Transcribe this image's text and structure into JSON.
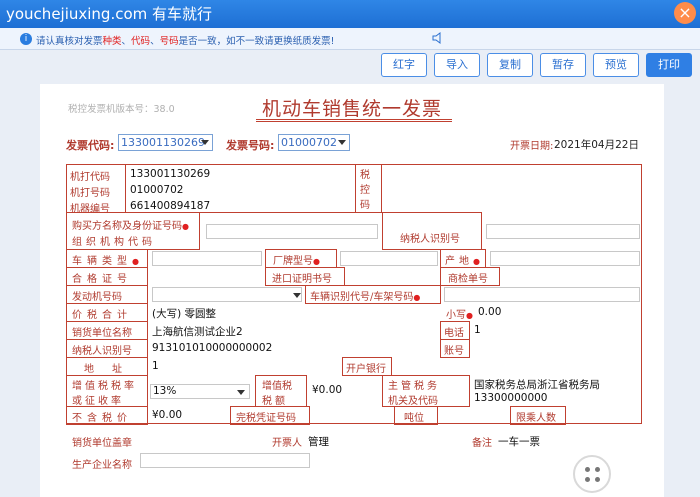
{
  "watermark": "youchejiuxing.com 有车就行",
  "notice": {
    "pre": "请认真核对发票",
    "w1": "种类",
    "sep1": "、",
    "w2": "代码",
    "sep2": "、",
    "w3": "号码",
    "post": "是否一致，如不一致请更换纸质发票!"
  },
  "toolbar": {
    "buttons": [
      "红字",
      "导入",
      "复制",
      "暂存",
      "预览",
      "打印"
    ]
  },
  "invoice": {
    "version": "税控发票机版本号：38.0",
    "title": "机动车销售统一发票",
    "code_label": "发票代码:",
    "code_value": "133001130269",
    "number_label": "发票号码:",
    "number_value": "01000702",
    "date_label": "开票日期:",
    "date_value": "2021年04月22日",
    "machine_labels": [
      "机打代码",
      "机打号码",
      "机器编号"
    ],
    "machine_values": [
      "133001130269",
      "01000702",
      "661400894187"
    ],
    "tax_ctrl_label": "税控码",
    "buyer_label_1": "购买方名称及身份证号码",
    "buyer_label_2": "组织机构代码",
    "taxpayer_id_label": "纳税人识别号",
    "vehicle_type_label": "车辆类型",
    "brand_model_label": "厂牌型号",
    "origin_label": "产地",
    "cert_no_label": "合格证号",
    "import_cert_label": "进口证明书号",
    "inspection_label": "商检单号",
    "engine_no_label": "发动机号码",
    "vin_label": "车辆识别代号/车架号码",
    "total_label": "价税合计",
    "total_upper": "(大写)  零圆整",
    "small_label": "小写",
    "total_lower": "0.00",
    "seller_name_label": "销货单位名称",
    "seller_name": "上海航信测试企业2",
    "phone_label": "电话",
    "phone_value": "1",
    "seller_tax_id_label": "纳税人识别号",
    "seller_tax_id": "913101010000000002",
    "account_label": "账号",
    "address_label": "地址",
    "address_value": "1",
    "bank_label": "开户银行",
    "vat_rate_label_1": "增值税税率",
    "vat_rate_label_2": "或征收率",
    "vat_rate_value": "13%",
    "vat_amount_label_1": "增值税",
    "vat_amount_label_2": "税额",
    "vat_amount_value": "¥0.00",
    "authority_label_1": "主管税务",
    "authority_label_2": "机关及代码",
    "authority_name": "国家税务总局浙江省税务局",
    "authority_code": "13300000000",
    "excl_tax_label": "不含税价",
    "excl_tax_value": "¥0.00",
    "completion_label": "完税凭证号码",
    "tonnage_label": "吨位",
    "passenger_label": "限乘人数",
    "seller_stamp_label": "销货单位盖章",
    "issuer_label": "开票人",
    "issuer_value": "管理",
    "remark_label": "备注",
    "remark_value": "一车一票",
    "manufacturer_label": "生产企业名称"
  }
}
